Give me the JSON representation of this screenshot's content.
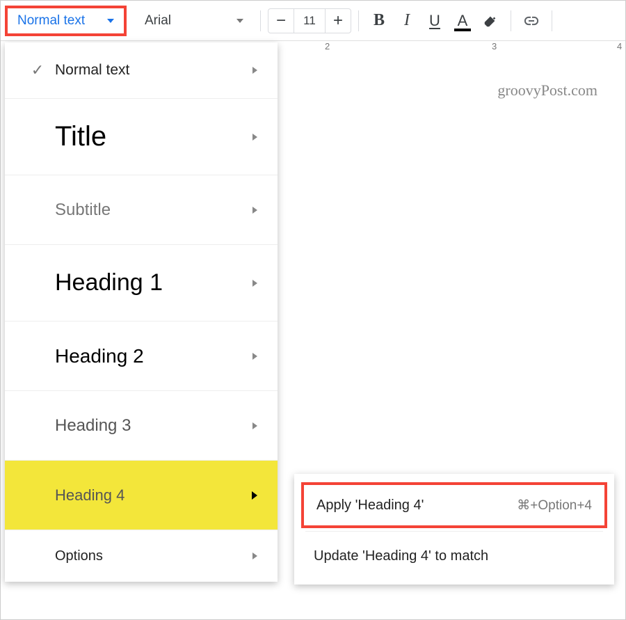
{
  "toolbar": {
    "style_label": "Normal text",
    "font_label": "Arial",
    "font_size": "11"
  },
  "ruler": {
    "n2": "2",
    "n3": "3",
    "n4": "4"
  },
  "watermark": "groovyPost.com",
  "styles_menu": {
    "items": [
      {
        "label": "Normal text",
        "checked": true
      },
      {
        "label": "Title"
      },
      {
        "label": "Subtitle"
      },
      {
        "label": "Heading 1"
      },
      {
        "label": "Heading 2"
      },
      {
        "label": "Heading 3"
      },
      {
        "label": "Heading 4",
        "hover": true
      },
      {
        "label": "Options"
      }
    ]
  },
  "submenu": {
    "apply_label": "Apply 'Heading 4'",
    "apply_shortcut": "⌘+Option+4",
    "update_label": "Update 'Heading 4' to match"
  }
}
